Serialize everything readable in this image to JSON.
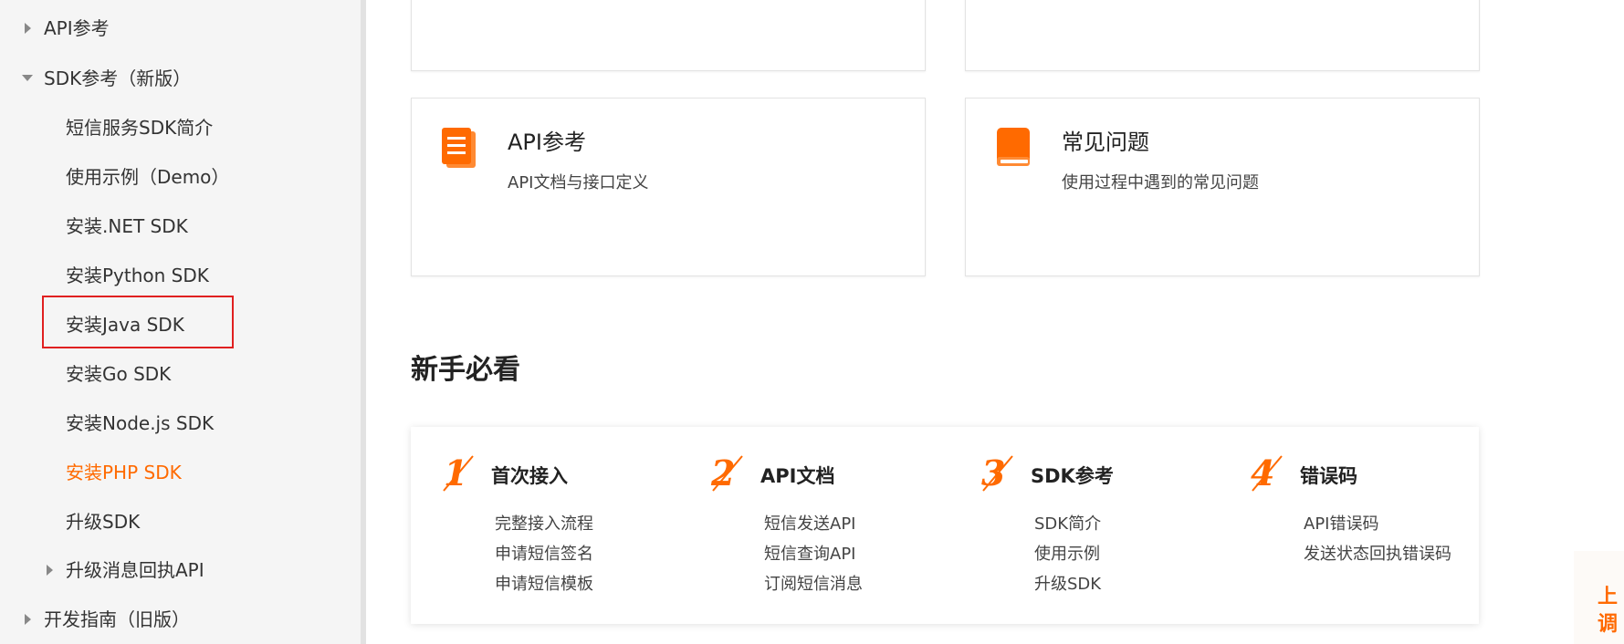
{
  "sidebar": {
    "items": [
      {
        "label": "API参考",
        "caret": "right"
      },
      {
        "label": "SDK参考（新版）",
        "caret": "down"
      },
      {
        "label": "短信服务SDK简介"
      },
      {
        "label": "使用示例（Demo）"
      },
      {
        "label": "安装.NET SDK"
      },
      {
        "label": "安装Python SDK"
      },
      {
        "label": "安装Java SDK"
      },
      {
        "label": "安装Go SDK"
      },
      {
        "label": "安装Node.js SDK"
      },
      {
        "label": "安装PHP SDK",
        "active": true
      },
      {
        "label": "升级SDK"
      },
      {
        "label": "升级消息回执API",
        "caret": "right"
      },
      {
        "label": "开发指南（旧版）",
        "caret": "right"
      }
    ]
  },
  "cards": [
    {
      "title": "API参考",
      "subtitle": "API文档与接口定义",
      "icon": "document-icon"
    },
    {
      "title": "常见问题",
      "subtitle": "使用过程中遇到的常见问题",
      "icon": "book-icon"
    }
  ],
  "newbie": {
    "title": "新手必看",
    "steps": [
      {
        "number": "1",
        "title": "首次接入",
        "links": [
          "完整接入流程",
          "申请短信签名",
          "申请短信模板"
        ]
      },
      {
        "number": "2",
        "title": "API文档",
        "links": [
          "短信发送API",
          "短信查询API",
          "订阅短信消息"
        ]
      },
      {
        "number": "3",
        "title": "SDK参考",
        "links": [
          "SDK简介",
          "使用示例",
          "升级SDK"
        ]
      },
      {
        "number": "4",
        "title": "错误码",
        "links": [
          "API错误码",
          "发送状态回执错误码"
        ]
      }
    ]
  },
  "edge_widget": {
    "line1": "上",
    "line2": "调"
  },
  "colors": {
    "accent": "#ff6a00",
    "highlight": "#e02020",
    "sidebar_bg": "#f5f5f5"
  }
}
